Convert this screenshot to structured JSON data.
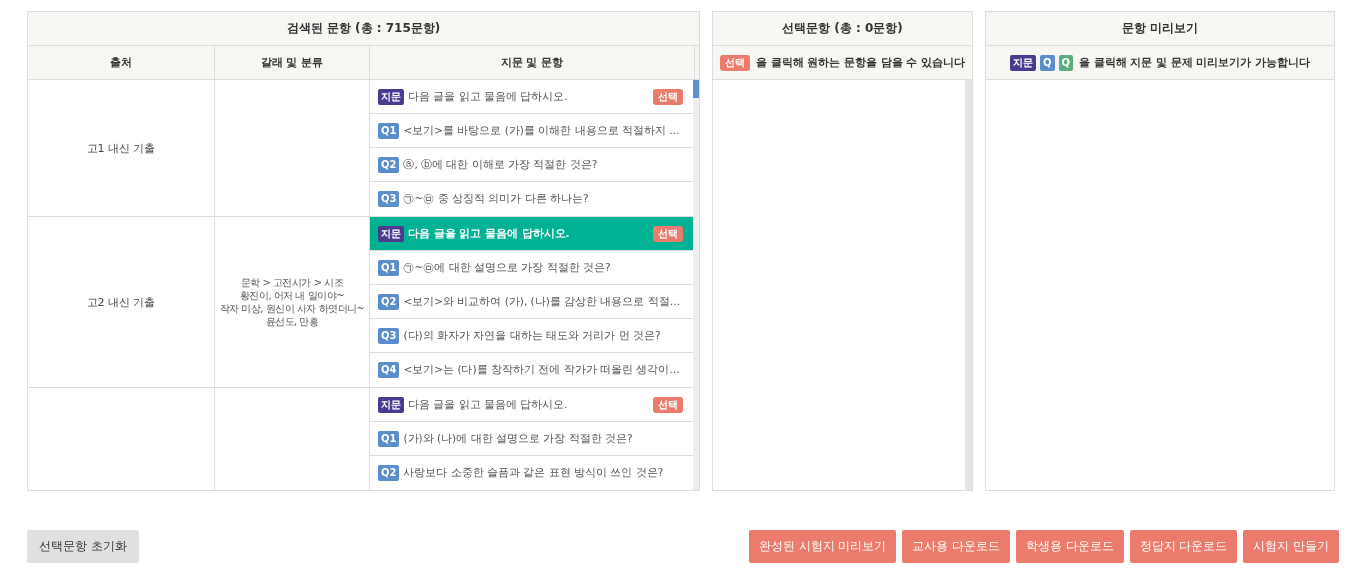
{
  "search_panel": {
    "title": "검색된 문항 (총 : 715문항)",
    "columns": [
      "출처",
      "갈래 및 분류",
      "지문 및 문항"
    ],
    "groups": [
      {
        "source": "고1 내신 기출",
        "items": [
          {
            "kind": "passage",
            "tag": "지문",
            "text": "다음 글을 읽고 물음에 답하시오.",
            "select_label": "선택",
            "selected": false
          },
          {
            "kind": "question",
            "tag": "Q1",
            "text": "<보기>를 바탕으로 (가)를 이해한 내용으로 적절하지 …"
          },
          {
            "kind": "question",
            "tag": "Q2",
            "text": "ⓐ, ⓑ에 대한 이해로 가장 적절한 것은?"
          },
          {
            "kind": "question",
            "tag": "Q3",
            "text": "㉠~㉤ 중 상징적 의미가 다른 하나는?"
          }
        ]
      },
      {
        "source": "고2 내신 기출",
        "category": [
          "문학 > 고전시가 > 시조",
          "황진이, 어저 내 일이야~",
          "작자 미상, 원신이 사자 하엿더니~",
          "윤선도, 만흥"
        ],
        "items": [
          {
            "kind": "passage",
            "tag": "지문",
            "text": "다음 글을 읽고 물음에 답하시오.",
            "select_label": "선택",
            "selected": true
          },
          {
            "kind": "question",
            "tag": "Q1",
            "text": "㉠~㉤에 대한 설명으로 가장 적절한 것은?"
          },
          {
            "kind": "question",
            "tag": "Q2",
            "text": "<보기>와 비교하여 (가), (나)를 감상한 내용으로 적절…"
          },
          {
            "kind": "question",
            "tag": "Q3",
            "text": "(다)의 화자가 자연을 대하는 태도와 거리가 먼 것은?"
          },
          {
            "kind": "question",
            "tag": "Q4",
            "text": "<보기>는 (다)를 창작하기 전에 작가가 떠올린 생각이…"
          }
        ]
      },
      {
        "items": [
          {
            "kind": "passage",
            "tag": "지문",
            "text": "다음 글을 읽고 물음에 답하시오.",
            "select_label": "선택",
            "selected": false
          },
          {
            "kind": "question",
            "tag": "Q1",
            "text": "(가)와 (나)에 대한 설명으로 가장 적절한 것은?"
          },
          {
            "kind": "question",
            "tag": "Q2",
            "text": "사랑보다 소중한 슬픔과 같은 표현 방식이 쓰인 것은?"
          }
        ]
      }
    ]
  },
  "selected_panel": {
    "title": "선택문항 (총 : 0문항)",
    "hint": [
      {
        "kind": "select",
        "text": "선택"
      },
      {
        "kind": "text",
        "text": "을 클릭해 원하는 문항을 담을 수 있습니다"
      }
    ]
  },
  "preview_panel": {
    "title": "문항 미리보기",
    "hint": [
      {
        "kind": "passage",
        "text": "지문"
      },
      {
        "kind": "question",
        "text": "Q"
      },
      {
        "kind": "answer",
        "text": "Q"
      },
      {
        "kind": "text",
        "text": "을 클릭해 지문 및 문제 미리보기가 가능합니다"
      }
    ]
  },
  "reset_button": "선택문항 초기화",
  "action_buttons": [
    "완성된 시험지 미리보기",
    "교사용 다운로드",
    "학생용 다운로드",
    "정답지 다운로드",
    "시험지 만들기"
  ]
}
